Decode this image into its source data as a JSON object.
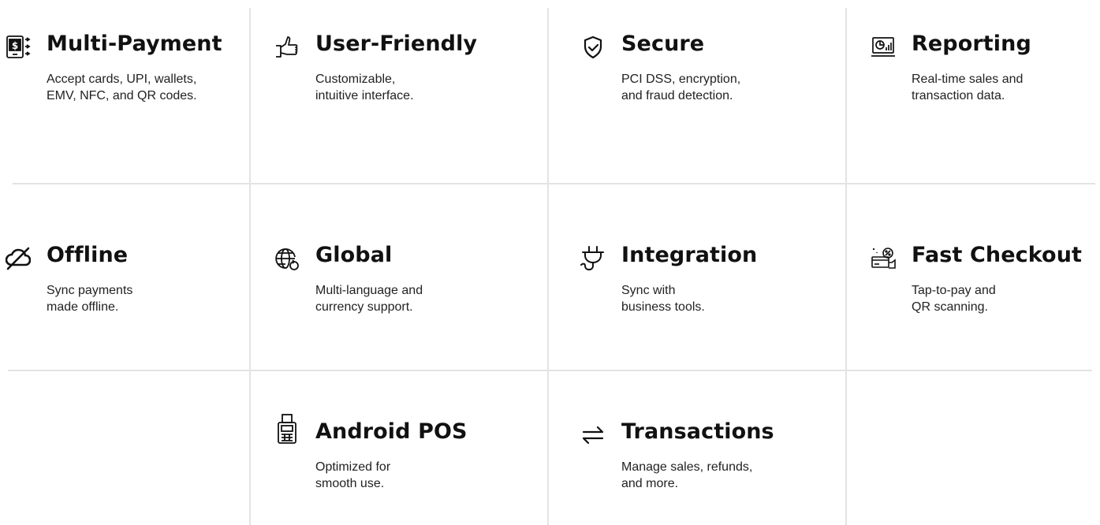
{
  "features": [
    {
      "title": "Multi-Payment",
      "desc": "Accept cards, UPI, wallets,\nEMV, NFC, and QR codes.",
      "icon": "mobile-payment-icon"
    },
    {
      "title": "User-Friendly",
      "desc": "Customizable,\nintuitive interface.",
      "icon": "thumbs-up-icon"
    },
    {
      "title": "Secure",
      "desc": "PCI DSS, encryption,\nand fraud detection.",
      "icon": "shield-check-icon"
    },
    {
      "title": "Reporting",
      "desc": "Real-time sales and\ntransaction data.",
      "icon": "report-chart-icon"
    },
    {
      "title": "Offline",
      "desc": "Sync payments\nmade offline.",
      "icon": "cloud-off-icon"
    },
    {
      "title": "Global",
      "desc": "Multi-language and\ncurrency support.",
      "icon": "globe-icon"
    },
    {
      "title": "Integration",
      "desc": "Sync with\nbusiness tools.",
      "icon": "plug-icon"
    },
    {
      "title": "Fast Checkout",
      "desc": "Tap-to-pay and\nQR scanning.",
      "icon": "card-checkout-icon"
    },
    {
      "title": "Android POS",
      "desc": "Optimized for\nsmooth use.",
      "icon": "pos-terminal-icon"
    },
    {
      "title": "Transactions",
      "desc": "Manage sales, refunds,\nand more.",
      "icon": "swap-arrows-icon"
    }
  ],
  "colors": {
    "text": "#111111",
    "divider": "#e3e3e3",
    "background": "#ffffff"
  }
}
